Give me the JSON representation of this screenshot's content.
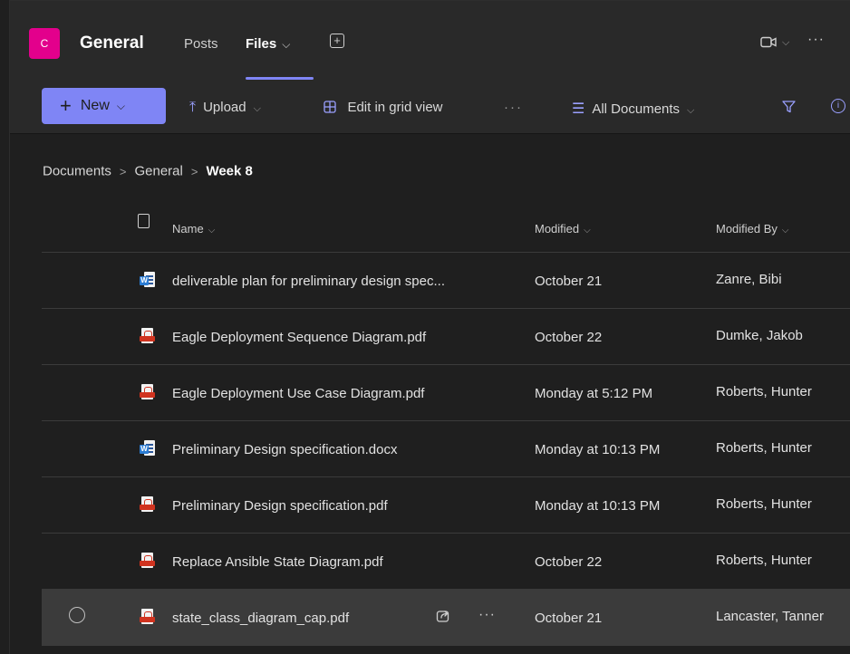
{
  "header": {
    "avatar_initial": "C",
    "team_name": "General",
    "tabs": [
      {
        "label": "Posts"
      },
      {
        "label": "Files",
        "active": true
      }
    ],
    "add_tab_glyph": "+",
    "video_icon": "video-icon",
    "more_glyph": "···"
  },
  "commandbar": {
    "new_label": "New",
    "upload_label": "Upload",
    "grid_label": "Edit in grid view",
    "more_glyph": "···",
    "view_label": "All Documents"
  },
  "breadcrumb": {
    "items": [
      "Documents",
      "General"
    ],
    "current": "Week 8"
  },
  "table": {
    "columns": {
      "name": "Name",
      "modified": "Modified",
      "modified_by": "Modified By"
    },
    "rows": [
      {
        "type": "word",
        "name": "deliverable plan for preliminary design spec...",
        "modified": "October 21",
        "modified_by": "Zanre, Bibi"
      },
      {
        "type": "pdf",
        "name": "Eagle Deployment Sequence Diagram.pdf",
        "modified": "October 22",
        "modified_by": "Dumke, Jakob"
      },
      {
        "type": "pdf",
        "name": "Eagle Deployment Use Case Diagram.pdf",
        "modified": "Monday at 5:12 PM",
        "modified_by": "Roberts, Hunter"
      },
      {
        "type": "word",
        "name": "Preliminary Design specification.docx",
        "modified": "Monday at 10:13 PM",
        "modified_by": "Roberts, Hunter"
      },
      {
        "type": "pdf",
        "name": "Preliminary Design specification.pdf",
        "modified": "Monday at 10:13 PM",
        "modified_by": "Roberts, Hunter"
      },
      {
        "type": "pdf",
        "name": "Replace Ansible State Diagram.pdf",
        "modified": "October 22",
        "modified_by": "Roberts, Hunter"
      },
      {
        "type": "pdf",
        "name": "state_class_diagram_cap.pdf",
        "modified": "October 21",
        "modified_by": "Lancaster, Tanner",
        "hovered": true
      }
    ]
  },
  "colors": {
    "accent": "#7f85f5",
    "avatar": "#e3008c",
    "background": "#1f1f1f",
    "bar": "#292929"
  }
}
